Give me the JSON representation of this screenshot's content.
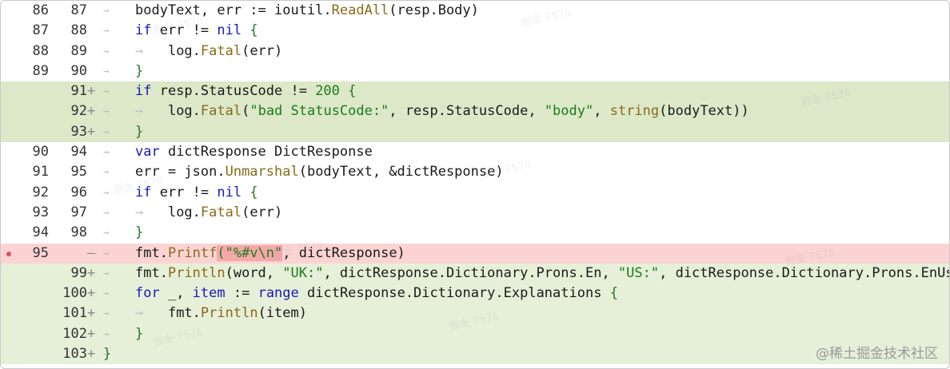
{
  "watermark": "@稀土掘金技术社区",
  "faint_watermark": "掘金 7576",
  "lines": [
    {
      "old": "86",
      "new": "87",
      "mark": "",
      "type": "ctx",
      "code": [
        {
          "t": "bodyText, err := ioutil.",
          "c": ""
        },
        {
          "t": "ReadAll",
          "c": "fn"
        },
        {
          "t": "(resp.Body)",
          "c": ""
        }
      ]
    },
    {
      "old": "87",
      "new": "88",
      "mark": "",
      "type": "ctx",
      "code": [
        {
          "t": "if",
          "c": "kw"
        },
        {
          "t": " err != ",
          "c": ""
        },
        {
          "t": "nil",
          "c": "kw"
        },
        {
          "t": " {",
          "c": "brace"
        }
      ]
    },
    {
      "old": "88",
      "new": "89",
      "mark": "",
      "type": "ctx",
      "indent": true,
      "code": [
        {
          "t": "log.",
          "c": ""
        },
        {
          "t": "Fatal",
          "c": "fn"
        },
        {
          "t": "(err)",
          "c": ""
        }
      ]
    },
    {
      "old": "89",
      "new": "90",
      "mark": "",
      "type": "ctx",
      "code": [
        {
          "t": "}",
          "c": "brace"
        }
      ]
    },
    {
      "old": "",
      "new": "91",
      "mark": "+",
      "type": "added",
      "code": [
        {
          "t": "if",
          "c": "kw"
        },
        {
          "t": " resp.StatusCode != ",
          "c": ""
        },
        {
          "t": "200",
          "c": "num"
        },
        {
          "t": " {",
          "c": "brace"
        }
      ]
    },
    {
      "old": "",
      "new": "92",
      "mark": "+",
      "type": "added",
      "indent": true,
      "code": [
        {
          "t": "log.",
          "c": ""
        },
        {
          "t": "Fatal",
          "c": "fn"
        },
        {
          "t": "(",
          "c": ""
        },
        {
          "t": "\"bad StatusCode:\"",
          "c": "str"
        },
        {
          "t": ", resp.StatusCode, ",
          "c": ""
        },
        {
          "t": "\"body\"",
          "c": "str"
        },
        {
          "t": ", ",
          "c": ""
        },
        {
          "t": "string",
          "c": "fn"
        },
        {
          "t": "(bodyText))",
          "c": ""
        }
      ]
    },
    {
      "old": "",
      "new": "93",
      "mark": "+",
      "type": "added",
      "code": [
        {
          "t": "}",
          "c": "brace"
        }
      ]
    },
    {
      "old": "90",
      "new": "94",
      "mark": "",
      "type": "ctx",
      "code": [
        {
          "t": "var",
          "c": "kw"
        },
        {
          "t": " dictResponse DictResponse",
          "c": ""
        }
      ]
    },
    {
      "old": "91",
      "new": "95",
      "mark": "",
      "type": "ctx",
      "code": [
        {
          "t": "err = json.",
          "c": ""
        },
        {
          "t": "Unmarshal",
          "c": "fn"
        },
        {
          "t": "(bodyText, &dictResponse)",
          "c": ""
        }
      ]
    },
    {
      "old": "92",
      "new": "96",
      "mark": "",
      "type": "ctx",
      "code": [
        {
          "t": "if",
          "c": "kw"
        },
        {
          "t": " err != ",
          "c": ""
        },
        {
          "t": "nil",
          "c": "kw"
        },
        {
          "t": " {",
          "c": "brace"
        }
      ]
    },
    {
      "old": "93",
      "new": "97",
      "mark": "",
      "type": "ctx",
      "indent": true,
      "code": [
        {
          "t": "log.",
          "c": ""
        },
        {
          "t": "Fatal",
          "c": "fn"
        },
        {
          "t": "(err)",
          "c": ""
        }
      ]
    },
    {
      "old": "94",
      "new": "98",
      "mark": "",
      "type": "ctx",
      "code": [
        {
          "t": "}",
          "c": "brace"
        }
      ]
    },
    {
      "old": "95",
      "new": "",
      "mark": "—",
      "type": "removed",
      "breakpoint": true,
      "code": [
        {
          "t": "fmt.",
          "c": ""
        },
        {
          "t": "Printf",
          "c": "fn"
        },
        {
          "t": "(\"%#v\\n\"",
          "c": "hl-red str"
        },
        {
          "t": ", dictResponse)",
          "c": ""
        }
      ]
    },
    {
      "old": "",
      "new": "99",
      "mark": "+",
      "type": "trail",
      "code": [
        {
          "t": "fmt.",
          "c": ""
        },
        {
          "t": "Println",
          "c": "fn"
        },
        {
          "t": "(word, ",
          "c": ""
        },
        {
          "t": "\"UK:\"",
          "c": "str"
        },
        {
          "t": ", dictResponse.Dictionary.Prons.En, ",
          "c": ""
        },
        {
          "t": "\"US:\"",
          "c": "str"
        },
        {
          "t": ", dictResponse.Dictionary.Prons.EnUs)",
          "c": ""
        }
      ]
    },
    {
      "old": "",
      "new": "100",
      "mark": "+",
      "type": "trail",
      "code": [
        {
          "t": "for",
          "c": "kw"
        },
        {
          "t": " _, ",
          "c": ""
        },
        {
          "t": "item",
          "c": "kw"
        },
        {
          "t": " := ",
          "c": ""
        },
        {
          "t": "range",
          "c": "kw"
        },
        {
          "t": " dictResponse.Dictionary.Explanations ",
          "c": ""
        },
        {
          "t": "{",
          "c": "brace"
        }
      ]
    },
    {
      "old": "",
      "new": "101",
      "mark": "+",
      "type": "trail",
      "indent": true,
      "code": [
        {
          "t": "fmt.",
          "c": ""
        },
        {
          "t": "Println",
          "c": "fn"
        },
        {
          "t": "(item)",
          "c": ""
        }
      ]
    },
    {
      "old": "",
      "new": "102",
      "mark": "+",
      "type": "trail",
      "code": [
        {
          "t": "}",
          "c": "brace"
        }
      ]
    },
    {
      "old": "",
      "new": "103",
      "mark": "+",
      "type": "trail",
      "code": [
        {
          "t": "}",
          "c": "brace"
        }
      ],
      "no_indent": true
    }
  ]
}
